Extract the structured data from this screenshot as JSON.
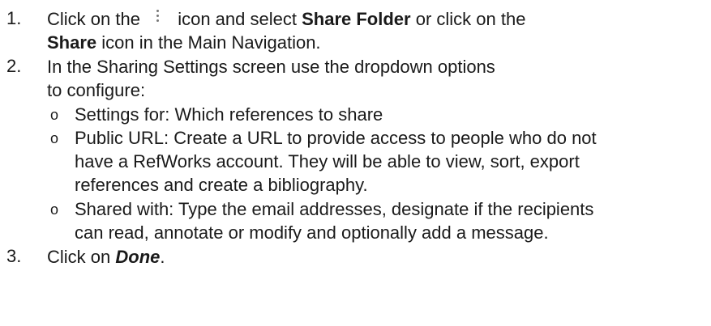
{
  "steps": [
    {
      "number": "1.",
      "lines": [
        {
          "pre": "Click on the",
          "post": "icon and select",
          "bold": "Share Folder",
          "tail": "or click on the"
        },
        {
          "bold": "Share",
          "tail": "icon in the Main Navigation."
        }
      ],
      "icon": "kebab-menu-icon"
    },
    {
      "number": "2.",
      "lines": [
        "In the Sharing Settings screen use the dropdown options",
        "to configure:"
      ],
      "bullet_mark": "o",
      "bullets": [
        {
          "lines": [
            "Settings for: Which references to share"
          ]
        },
        {
          "lines": [
            "Public URL: Create a URL to provide access to people who do not",
            "have a RefWorks account. They will be able to view, sort, export",
            "references and create a bibliography."
          ]
        },
        {
          "lines": [
            "Shared with: Type the email addresses, designate if the recipients",
            "can read, annotate or modify and optionally add a message."
          ]
        }
      ]
    },
    {
      "number": "3.",
      "pre": "Click on",
      "emph": "Done",
      "post": "."
    }
  ]
}
